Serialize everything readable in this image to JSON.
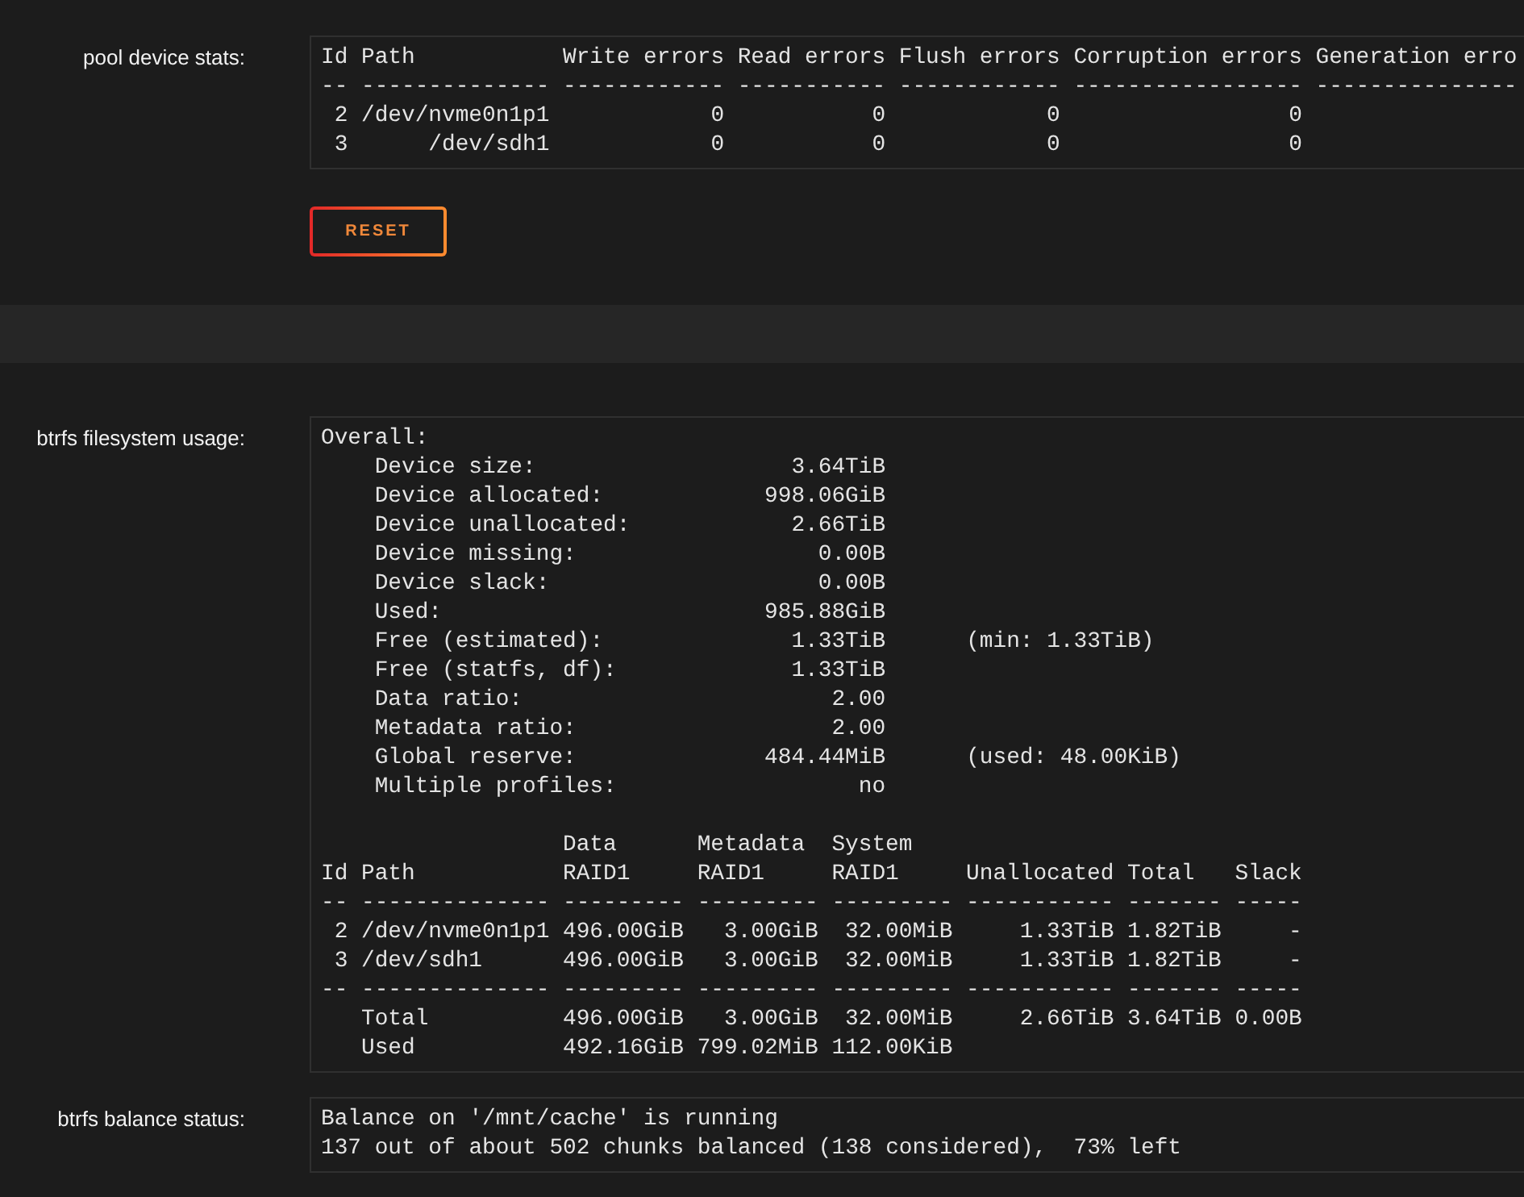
{
  "panels": [
    {
      "fields": [
        {
          "label": "pool device stats:",
          "blocks": [
            {
              "kind": "table",
              "columns": [
                {
                  "header": [
                    "Id"
                  ]
                },
                {
                  "header": [
                    "Path"
                  ]
                },
                {
                  "header": [
                    "Write errors"
                  ]
                },
                {
                  "header": [
                    "Read errors"
                  ]
                },
                {
                  "header": [
                    "Flush errors"
                  ]
                },
                {
                  "header": [
                    "Corruption errors"
                  ]
                },
                {
                  "header": [
                    "Generation erro"
                  ]
                }
              ],
              "groups": [
                {
                  "rule": [
                    "--",
                    "--------------",
                    "------------",
                    "-----------",
                    "------------",
                    "-----------------",
                    "---------------"
                  ],
                  "rows": [
                    [
                      " 2",
                      "/dev/nvme0n1p1",
                      "           0",
                      "          0",
                      "           0",
                      "                0"
                    ],
                    [
                      " 3",
                      "     /dev/sdh1",
                      "           0",
                      "          0",
                      "           0",
                      "                0"
                    ]
                  ]
                }
              ]
            }
          ]
        }
      ],
      "buttons": [
        {
          "label": "RESET"
        }
      ]
    },
    {
      "fields": [
        {
          "label": "btrfs filesystem usage:",
          "blocks": [
            {
              "kind": "summary",
              "heading": "Overall:",
              "rows": [
                {
                  "label": "Device size:",
                  "value": "3.64TiB"
                },
                {
                  "label": "Device allocated:",
                  "value": "998.06GiB"
                },
                {
                  "label": "Device unallocated:",
                  "value": "2.66TiB"
                },
                {
                  "label": "Device missing:",
                  "value": "0.00B"
                },
                {
                  "label": "Device slack:",
                  "value": "0.00B"
                },
                {
                  "label": "Used:",
                  "value": "985.88GiB"
                },
                {
                  "label": "Free (estimated):",
                  "value": "1.33TiB",
                  "note": "(min: 1.33TiB)"
                },
                {
                  "label": "Free (statfs, df):",
                  "value": "1.33TiB"
                },
                {
                  "label": "Data ratio:",
                  "value": "2.00"
                },
                {
                  "label": "Metadata ratio:",
                  "value": "2.00"
                },
                {
                  "label": "Global reserve:",
                  "value": "484.44MiB",
                  "note": "(used: 48.00KiB)"
                },
                {
                  "label": "Multiple profiles:",
                  "value": "no"
                }
              ]
            },
            {
              "kind": "table",
              "columns": [
                {
                  "header": [
                    "Id"
                  ]
                },
                {
                  "header": [
                    "Path"
                  ]
                },
                {
                  "header": [
                    "Data",
                    "RAID1"
                  ]
                },
                {
                  "header": [
                    "Metadata",
                    "RAID1"
                  ]
                },
                {
                  "header": [
                    "System",
                    "RAID1"
                  ]
                },
                {
                  "header": [
                    "Unallocated"
                  ]
                },
                {
                  "header": [
                    "Total"
                  ]
                },
                {
                  "header": [
                    "Slack"
                  ]
                }
              ],
              "groups": [
                {
                  "rule": [
                    "--",
                    "--------------",
                    "---------",
                    "---------",
                    "---------",
                    "-----------",
                    "-------",
                    "-----"
                  ],
                  "rows": [
                    [
                      " 2",
                      "/dev/nvme0n1p1",
                      "496.00GiB",
                      "  3.00GiB",
                      " 32.00MiB",
                      "    1.33TiB",
                      "1.82TiB",
                      "    -"
                    ],
                    [
                      " 3",
                      "/dev/sdh1",
                      "496.00GiB",
                      "  3.00GiB",
                      " 32.00MiB",
                      "    1.33TiB",
                      "1.82TiB",
                      "    -"
                    ]
                  ]
                },
                {
                  "rule": [
                    "--",
                    "--------------",
                    "---------",
                    "---------",
                    "---------",
                    "-----------",
                    "-------",
                    "-----"
                  ],
                  "rows": [
                    [
                      "",
                      "Total",
                      "496.00GiB",
                      "  3.00GiB",
                      " 32.00MiB",
                      "    2.66TiB",
                      "3.64TiB",
                      "0.00B"
                    ],
                    [
                      "",
                      "Used",
                      "492.16GiB",
                      "799.02MiB",
                      "112.00KiB"
                    ]
                  ]
                }
              ]
            }
          ]
        },
        {
          "label": "btrfs balance status:",
          "blocks": [
            {
              "kind": "lines",
              "lines": [
                "Balance on '/mnt/cache' is running",
                "137 out of about 502 chunks balanced (138 considered),  73% left"
              ]
            }
          ]
        }
      ]
    }
  ]
}
